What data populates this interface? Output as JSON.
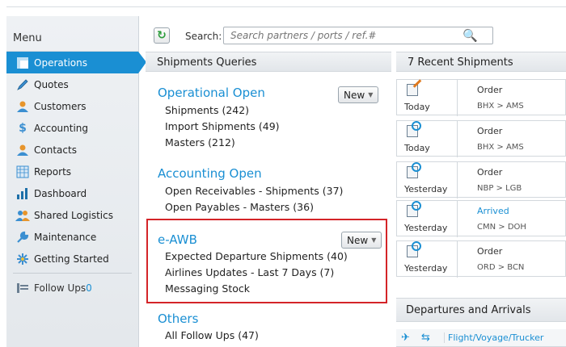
{
  "sidebar": {
    "title": "Menu",
    "items": [
      {
        "label": "Operations",
        "icon": "operations-icon",
        "active": true
      },
      {
        "label": "Quotes",
        "icon": "quotes-icon"
      },
      {
        "label": "Customers",
        "icon": "customers-icon"
      },
      {
        "label": "Accounting",
        "icon": "accounting-icon"
      },
      {
        "label": "Contacts",
        "icon": "contacts-icon"
      },
      {
        "label": "Reports",
        "icon": "reports-icon"
      },
      {
        "label": "Dashboard",
        "icon": "dashboard-icon"
      },
      {
        "label": "Shared Logistics",
        "icon": "shared-logistics-icon"
      },
      {
        "label": "Maintenance",
        "icon": "maintenance-icon"
      },
      {
        "label": "Getting Started",
        "icon": "getting-started-icon"
      }
    ],
    "followups": {
      "label": "Follow Ups",
      "count": "0"
    }
  },
  "header": {
    "search_label": "Search:",
    "search_placeholder": "Search partners / ports / ref.#"
  },
  "queries": {
    "title": "Shipments Queries",
    "sections": [
      {
        "title": "Operational Open",
        "has_new": true,
        "items": [
          "Shipments (242)",
          "Import Shipments (49)",
          "Masters (212)"
        ]
      },
      {
        "title": "Accounting Open",
        "has_new": false,
        "items": [
          "Open Receivables - Shipments (37)",
          "Open Payables - Masters (36)"
        ]
      },
      {
        "title": "e-AWB",
        "has_new": true,
        "items": [
          "Expected Departure Shipments (40)",
          "Airlines Updates - Last 7 Days (7)",
          "Messaging Stock"
        ]
      },
      {
        "title": "Others",
        "has_new": false,
        "items": [
          "All Follow Ups (47)"
        ]
      }
    ],
    "new_label": "New"
  },
  "recent": {
    "title": "7 Recent Shipments",
    "items": [
      {
        "day": "Today",
        "status": "Order",
        "route": "BHX > AMS",
        "icon": "edit-document-icon"
      },
      {
        "day": "Today",
        "status": "Order",
        "route": "BHX > AMS",
        "icon": "document-icon"
      },
      {
        "day": "Yesterday",
        "status": "Order",
        "route": "NBP > LGB",
        "icon": "document-icon"
      },
      {
        "day": "Yesterday",
        "status": "Arrived",
        "route": "CMN > DOH",
        "icon": "document-icon"
      },
      {
        "day": "Yesterday",
        "status": "Order",
        "route": "ORD > BCN",
        "icon": "document-icon"
      }
    ]
  },
  "departures": {
    "title": "Departures and Arrivals",
    "column": "Flight/Voyage/Trucker"
  },
  "colors": {
    "accent": "#1a8fd3",
    "highlight": "#d42428"
  }
}
